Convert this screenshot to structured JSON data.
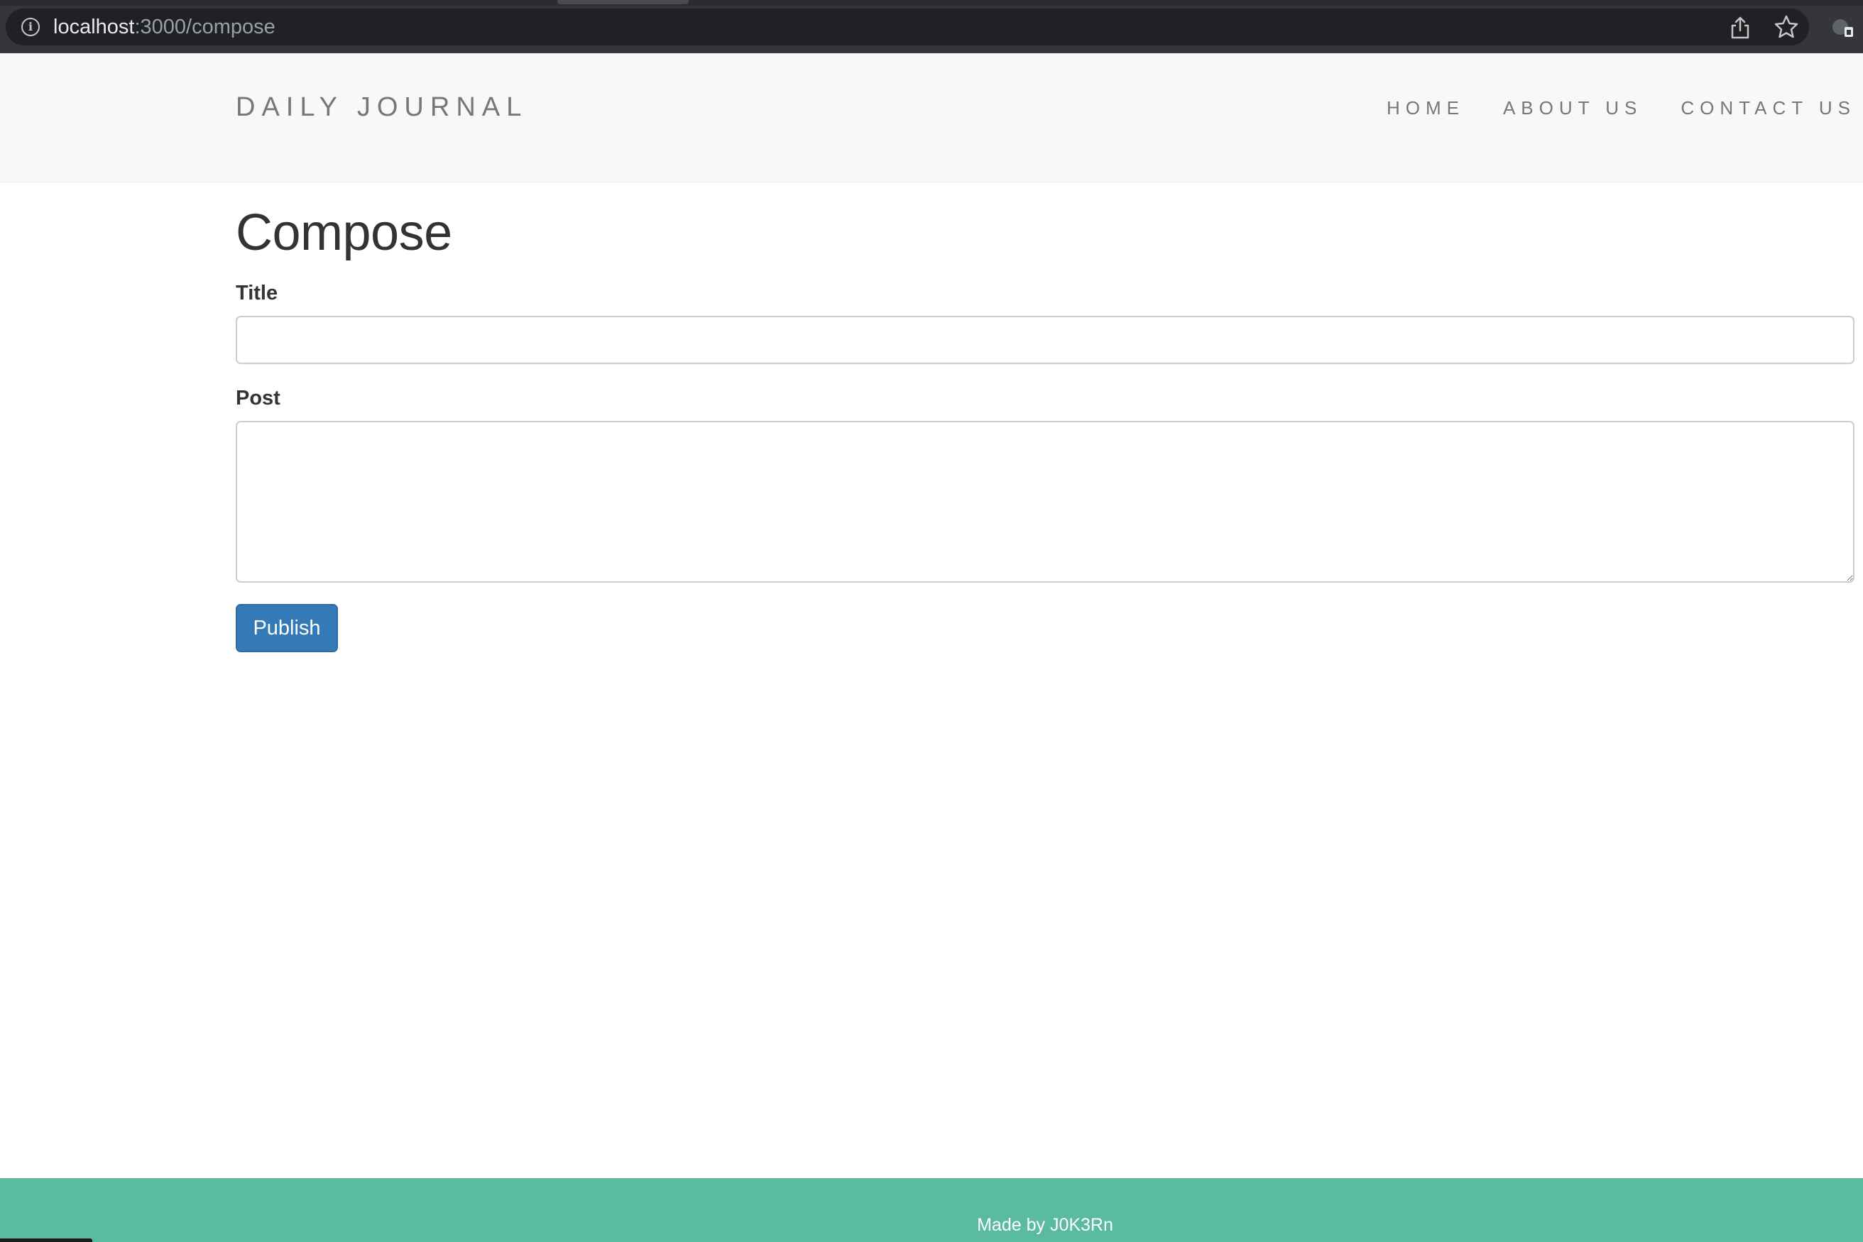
{
  "browser": {
    "url_host": "localhost",
    "url_path": ":3000/compose",
    "icons": [
      "info-icon",
      "share-icon",
      "star-icon",
      "extension-icon"
    ]
  },
  "header": {
    "brand": "DAILY JOURNAL",
    "nav": [
      {
        "label": "HOME"
      },
      {
        "label": "ABOUT US"
      },
      {
        "label": "CONTACT US"
      }
    ]
  },
  "compose": {
    "heading": "Compose",
    "title_label": "Title",
    "title_value": "",
    "post_label": "Post",
    "post_value": "",
    "publish_label": "Publish"
  },
  "footer": {
    "text": "Made by J0K3Rn"
  },
  "colors": {
    "header_bg": "#f8f8f8",
    "nav_text": "#777777",
    "publish_button": "#337ab7",
    "footer_bg": "#5abb9f",
    "browser_bar": "#35363a"
  }
}
